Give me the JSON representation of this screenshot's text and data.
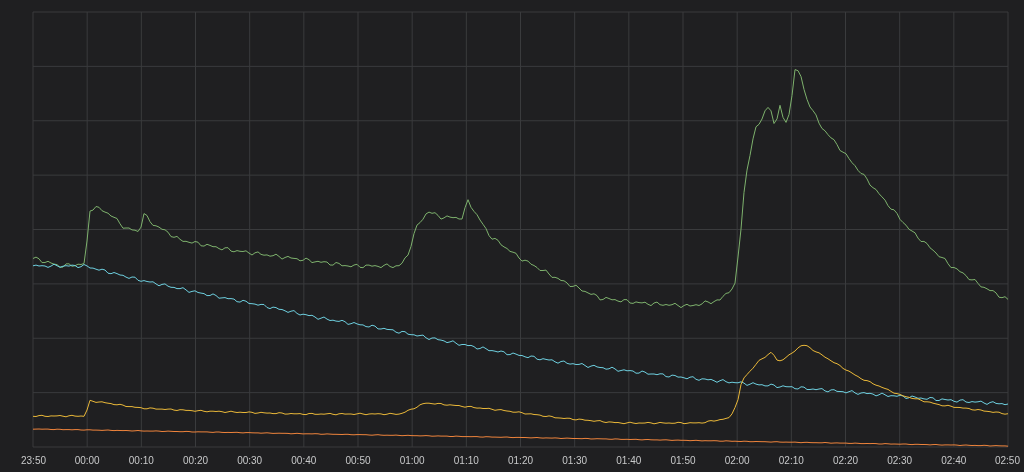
{
  "chart": {
    "x_axis_labels": [
      "23:50",
      "00:00",
      "00:10",
      "00:20",
      "00:30",
      "00:40",
      "00:50",
      "01:00",
      "01:10",
      "01:20",
      "01:30",
      "01:40",
      "01:50",
      "02:00",
      "02:10",
      "02:20",
      "02:30",
      "02:40",
      "02:50"
    ]
  }
}
